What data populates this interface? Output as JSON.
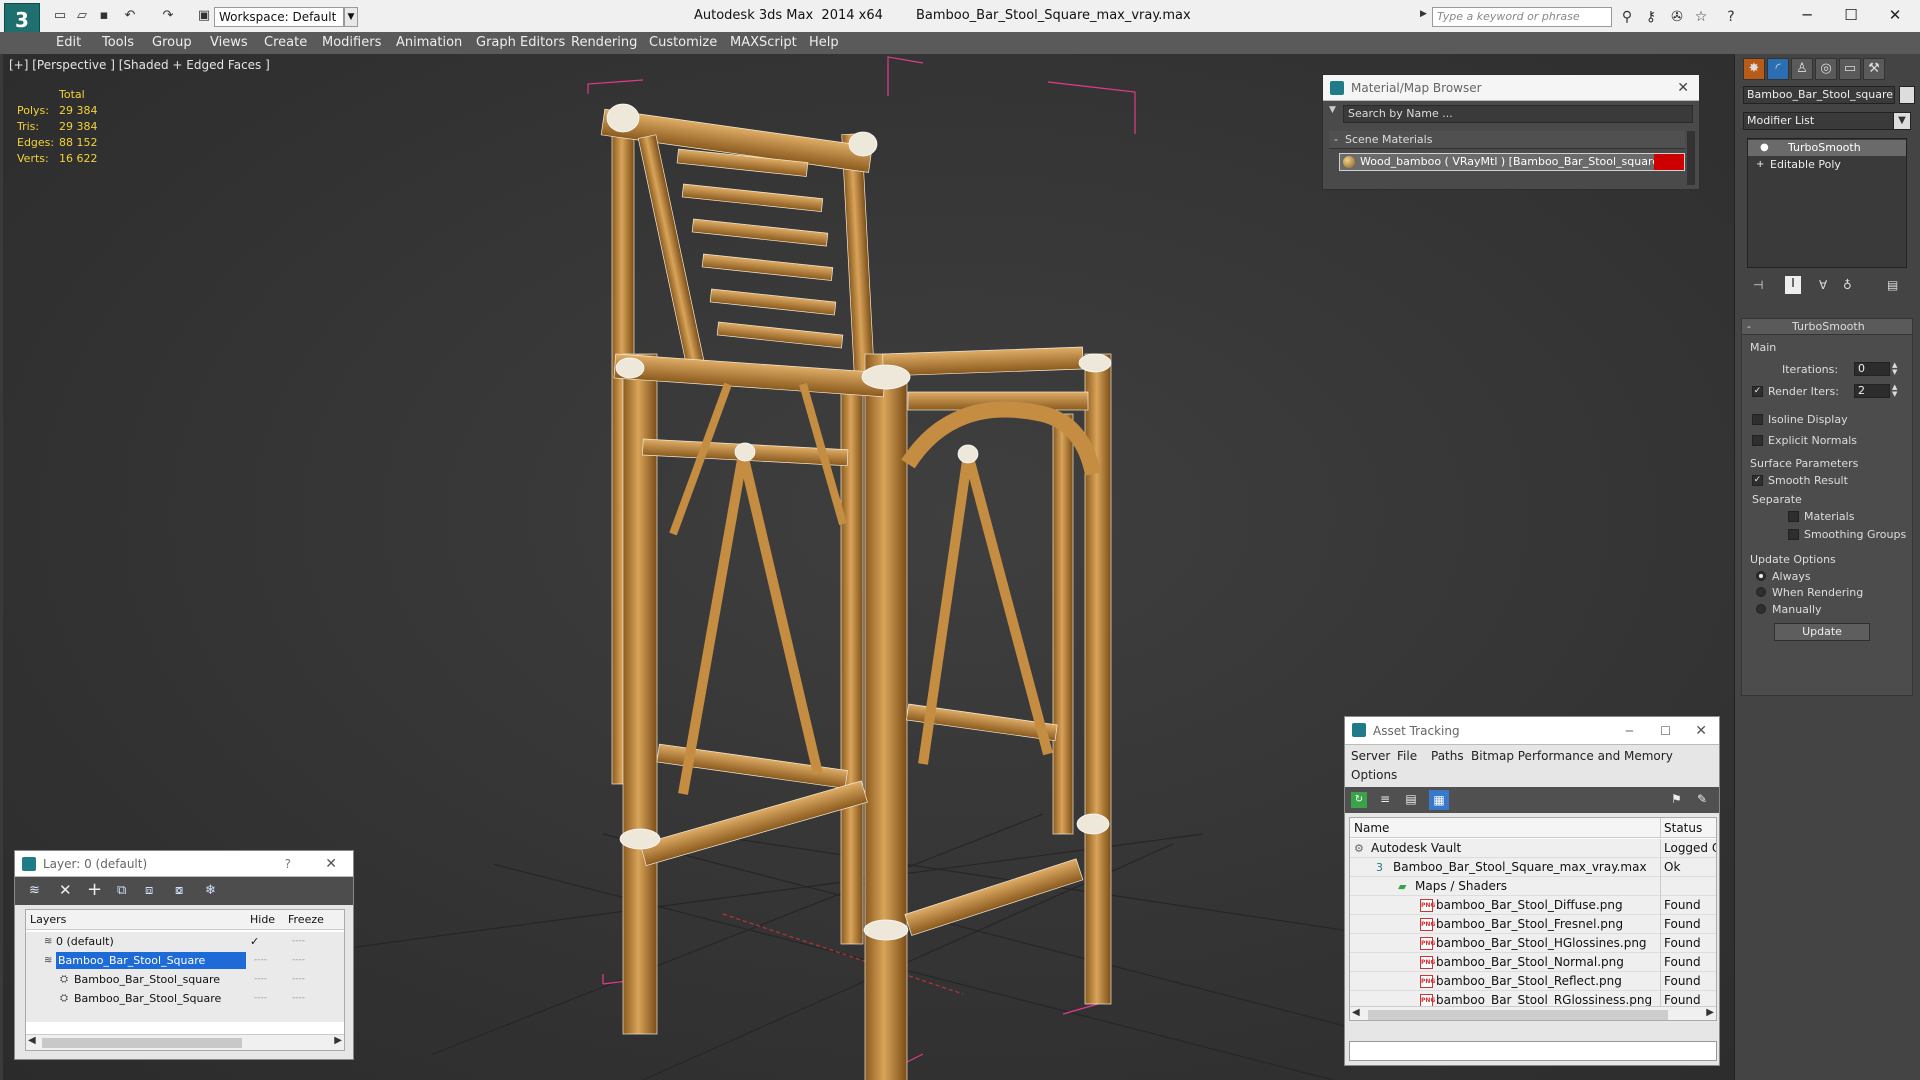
{
  "title_bar": {
    "app": "Autodesk 3ds Max  2014 x64",
    "file": "Bamboo_Bar_Stool_Square_max_vray.max",
    "workspace": "Workspace: Default",
    "search_placeholder": "Type a keyword or phrase"
  },
  "menu": [
    "Edit",
    "Tools",
    "Group",
    "Views",
    "Create",
    "Modifiers",
    "Animation",
    "Graph Editors",
    "Rendering",
    "Customize",
    "MAXScript",
    "Help"
  ],
  "viewport": {
    "label": "[+] [Perspective ] [Shaded + Edged Faces ]",
    "stats_header": "Total",
    "stats": [
      {
        "label": "Polys:",
        "value": "29 384"
      },
      {
        "label": "Tris:",
        "value": "29 384"
      },
      {
        "label": "Edges:",
        "value": "88 152"
      },
      {
        "label": "Verts:",
        "value": "16 622"
      }
    ]
  },
  "material_browser": {
    "title": "Material/Map Browser",
    "search_placeholder": "Search by Name ...",
    "group": "Scene Materials",
    "group_toggle": "-",
    "item": "Wood_bamboo ( VRayMtl ) [Bamboo_Bar_Stool_square]",
    "accent": "#cc0000"
  },
  "asset_tracking": {
    "title": "Asset Tracking",
    "menu": [
      "Server",
      "File",
      "Paths",
      "Bitmap Performance and Memory"
    ],
    "menu2": "Options",
    "columns": [
      "Name",
      "Status"
    ],
    "rows": [
      {
        "name": "Autodesk Vault",
        "status": "Logged O",
        "indent": 1,
        "icon": "vault-icon"
      },
      {
        "name": "Bamboo_Bar_Stool_Square_max_vray.max",
        "status": "Ok",
        "indent": 2,
        "icon": "max-file-icon"
      },
      {
        "name": "Maps / Shaders",
        "status": "",
        "indent": 3,
        "icon": "folder-icon"
      },
      {
        "name": "bamboo_Bar_Stool_Diffuse.png",
        "status": "Found",
        "indent": 4,
        "icon": "png-icon"
      },
      {
        "name": "bamboo_Bar_Stool_Fresnel.png",
        "status": "Found",
        "indent": 4,
        "icon": "png-icon"
      },
      {
        "name": "bamboo_Bar_Stool_HGlossines.png",
        "status": "Found",
        "indent": 4,
        "icon": "png-icon"
      },
      {
        "name": "bamboo_Bar_Stool_Normal.png",
        "status": "Found",
        "indent": 4,
        "icon": "png-icon"
      },
      {
        "name": "bamboo_Bar_Stool_Reflect.png",
        "status": "Found",
        "indent": 4,
        "icon": "png-icon"
      },
      {
        "name": "bamboo_Bar_Stool_RGlossiness.png",
        "status": "Found",
        "indent": 4,
        "icon": "png-icon"
      }
    ],
    "png_label": "PNG"
  },
  "layer_panel": {
    "title": "Layer: 0 (default)",
    "help": "?",
    "columns": [
      "Layers",
      "Hide",
      "Freeze"
    ],
    "rows": [
      {
        "name": "0 (default)",
        "selected": false,
        "indent": 1,
        "mark": "✓"
      },
      {
        "name": "Bamboo_Bar_Stool_Square",
        "selected": true,
        "indent": 1,
        "mark": ""
      },
      {
        "name": "Bamboo_Bar_Stool_square",
        "selected": false,
        "indent": 2,
        "mark": ""
      },
      {
        "name": "Bamboo_Bar_Stool_Square",
        "selected": false,
        "indent": 2,
        "mark": ""
      }
    ],
    "dash": "----"
  },
  "command_panel": {
    "object_name": "Bamboo_Bar_Stool_square",
    "modifier_list": "Modifier List",
    "stack": [
      "TurboSmooth",
      "Editable Poly"
    ],
    "turbosmooth": {
      "title": "TurboSmooth",
      "main": "Main",
      "iterations_label": "Iterations:",
      "iterations": "0",
      "render_iters_label": "Render Iters:",
      "render_iters": "2",
      "isoline": "Isoline Display",
      "explicit": "Explicit Normals",
      "surface": "Surface Parameters",
      "smooth_result": "Smooth Result",
      "separate": "Separate",
      "materials": "Materials",
      "smoothing_groups": "Smoothing Groups",
      "update_options": "Update Options",
      "always": "Always",
      "when_rendering": "When Rendering",
      "manually": "Manually",
      "update_btn": "Update",
      "collapse": "-"
    }
  }
}
